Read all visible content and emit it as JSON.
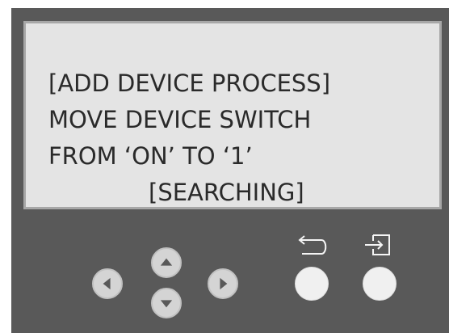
{
  "screen": {
    "lines": [
      "[ADD DEVICE PROCESS]",
      "MOVE DEVICE SWITCH",
      "FROM ‘ON’ TO ‘1’",
      "[SEARCHING]"
    ]
  },
  "controls": {
    "nav": [
      "left-arrow-icon",
      "up-arrow-icon",
      "down-arrow-icon",
      "right-arrow-icon"
    ],
    "back": {
      "icon": "back-icon"
    },
    "enter": {
      "icon": "enter-icon"
    }
  },
  "colors": {
    "panel": "#595959",
    "screen": "#e4e4e4",
    "screen_border": "#a7a7a7",
    "text": "#2a2a2a",
    "nav_button": "#d4d4d4",
    "arrow": "#595959",
    "action_button": "#f0f0f0",
    "icon_stroke": "#f5f5f5"
  }
}
